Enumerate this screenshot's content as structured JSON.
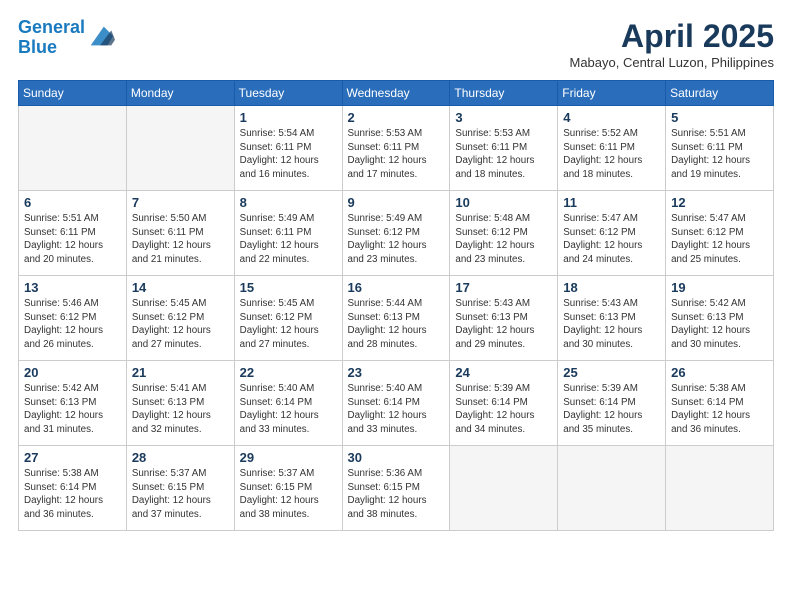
{
  "logo": {
    "line1": "General",
    "line2": "Blue"
  },
  "title": "April 2025",
  "location": "Mabayo, Central Luzon, Philippines",
  "days_of_week": [
    "Sunday",
    "Monday",
    "Tuesday",
    "Wednesday",
    "Thursday",
    "Friday",
    "Saturday"
  ],
  "weeks": [
    [
      {
        "day": "",
        "info": ""
      },
      {
        "day": "",
        "info": ""
      },
      {
        "day": "1",
        "info": "Sunrise: 5:54 AM\nSunset: 6:11 PM\nDaylight: 12 hours and 16 minutes."
      },
      {
        "day": "2",
        "info": "Sunrise: 5:53 AM\nSunset: 6:11 PM\nDaylight: 12 hours and 17 minutes."
      },
      {
        "day": "3",
        "info": "Sunrise: 5:53 AM\nSunset: 6:11 PM\nDaylight: 12 hours and 18 minutes."
      },
      {
        "day": "4",
        "info": "Sunrise: 5:52 AM\nSunset: 6:11 PM\nDaylight: 12 hours and 18 minutes."
      },
      {
        "day": "5",
        "info": "Sunrise: 5:51 AM\nSunset: 6:11 PM\nDaylight: 12 hours and 19 minutes."
      }
    ],
    [
      {
        "day": "6",
        "info": "Sunrise: 5:51 AM\nSunset: 6:11 PM\nDaylight: 12 hours and 20 minutes."
      },
      {
        "day": "7",
        "info": "Sunrise: 5:50 AM\nSunset: 6:11 PM\nDaylight: 12 hours and 21 minutes."
      },
      {
        "day": "8",
        "info": "Sunrise: 5:49 AM\nSunset: 6:11 PM\nDaylight: 12 hours and 22 minutes."
      },
      {
        "day": "9",
        "info": "Sunrise: 5:49 AM\nSunset: 6:12 PM\nDaylight: 12 hours and 23 minutes."
      },
      {
        "day": "10",
        "info": "Sunrise: 5:48 AM\nSunset: 6:12 PM\nDaylight: 12 hours and 23 minutes."
      },
      {
        "day": "11",
        "info": "Sunrise: 5:47 AM\nSunset: 6:12 PM\nDaylight: 12 hours and 24 minutes."
      },
      {
        "day": "12",
        "info": "Sunrise: 5:47 AM\nSunset: 6:12 PM\nDaylight: 12 hours and 25 minutes."
      }
    ],
    [
      {
        "day": "13",
        "info": "Sunrise: 5:46 AM\nSunset: 6:12 PM\nDaylight: 12 hours and 26 minutes."
      },
      {
        "day": "14",
        "info": "Sunrise: 5:45 AM\nSunset: 6:12 PM\nDaylight: 12 hours and 27 minutes."
      },
      {
        "day": "15",
        "info": "Sunrise: 5:45 AM\nSunset: 6:12 PM\nDaylight: 12 hours and 27 minutes."
      },
      {
        "day": "16",
        "info": "Sunrise: 5:44 AM\nSunset: 6:13 PM\nDaylight: 12 hours and 28 minutes."
      },
      {
        "day": "17",
        "info": "Sunrise: 5:43 AM\nSunset: 6:13 PM\nDaylight: 12 hours and 29 minutes."
      },
      {
        "day": "18",
        "info": "Sunrise: 5:43 AM\nSunset: 6:13 PM\nDaylight: 12 hours and 30 minutes."
      },
      {
        "day": "19",
        "info": "Sunrise: 5:42 AM\nSunset: 6:13 PM\nDaylight: 12 hours and 30 minutes."
      }
    ],
    [
      {
        "day": "20",
        "info": "Sunrise: 5:42 AM\nSunset: 6:13 PM\nDaylight: 12 hours and 31 minutes."
      },
      {
        "day": "21",
        "info": "Sunrise: 5:41 AM\nSunset: 6:13 PM\nDaylight: 12 hours and 32 minutes."
      },
      {
        "day": "22",
        "info": "Sunrise: 5:40 AM\nSunset: 6:14 PM\nDaylight: 12 hours and 33 minutes."
      },
      {
        "day": "23",
        "info": "Sunrise: 5:40 AM\nSunset: 6:14 PM\nDaylight: 12 hours and 33 minutes."
      },
      {
        "day": "24",
        "info": "Sunrise: 5:39 AM\nSunset: 6:14 PM\nDaylight: 12 hours and 34 minutes."
      },
      {
        "day": "25",
        "info": "Sunrise: 5:39 AM\nSunset: 6:14 PM\nDaylight: 12 hours and 35 minutes."
      },
      {
        "day": "26",
        "info": "Sunrise: 5:38 AM\nSunset: 6:14 PM\nDaylight: 12 hours and 36 minutes."
      }
    ],
    [
      {
        "day": "27",
        "info": "Sunrise: 5:38 AM\nSunset: 6:14 PM\nDaylight: 12 hours and 36 minutes."
      },
      {
        "day": "28",
        "info": "Sunrise: 5:37 AM\nSunset: 6:15 PM\nDaylight: 12 hours and 37 minutes."
      },
      {
        "day": "29",
        "info": "Sunrise: 5:37 AM\nSunset: 6:15 PM\nDaylight: 12 hours and 38 minutes."
      },
      {
        "day": "30",
        "info": "Sunrise: 5:36 AM\nSunset: 6:15 PM\nDaylight: 12 hours and 38 minutes."
      },
      {
        "day": "",
        "info": ""
      },
      {
        "day": "",
        "info": ""
      },
      {
        "day": "",
        "info": ""
      }
    ]
  ]
}
